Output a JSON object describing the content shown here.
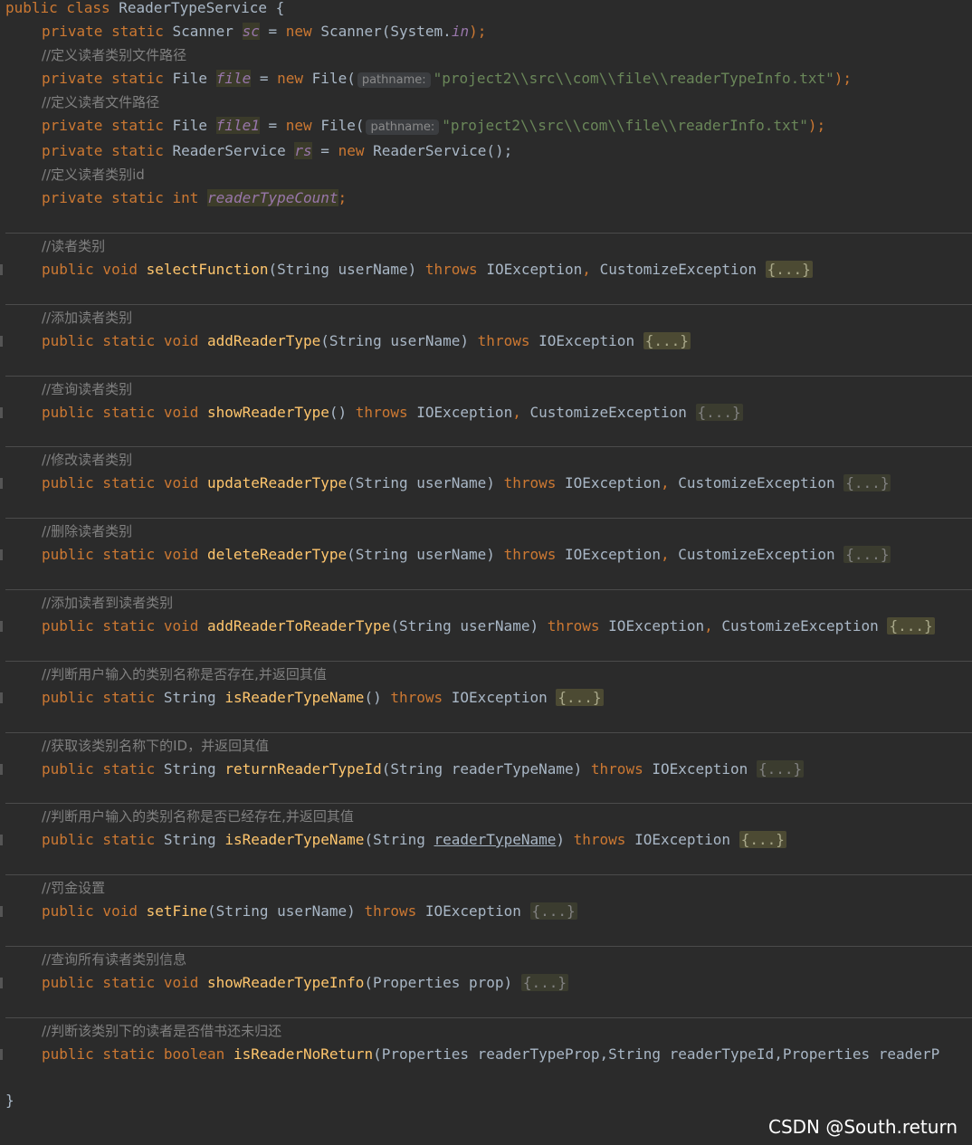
{
  "class_header": {
    "modifiers": "public class",
    "name": "ReaderTypeService",
    "brace": "{"
  },
  "fields": {
    "sc": {
      "mods": "private static",
      "type": "Scanner",
      "name": "sc",
      "assign": "=",
      "new_kw": "new",
      "init": "Scanner(System.",
      "in_field": "in",
      "tail": ");"
    },
    "c1": "//定义读者类别文件路径",
    "file": {
      "mods": "private static",
      "type": "File",
      "name": "file",
      "assign": "=",
      "new_kw": "new",
      "ctor": "File(",
      "hint": "pathname:",
      "path": "\"project2\\\\src\\\\com\\\\file\\\\readerTypeInfo.txt\"",
      "tail": ");"
    },
    "c2": "//定义读者文件路径",
    "file1": {
      "mods": "private static",
      "type": "File",
      "name": "file1",
      "assign": "=",
      "new_kw": "new",
      "ctor": "File(",
      "hint": "pathname:",
      "path": "\"project2\\\\src\\\\com\\\\file\\\\readerInfo.txt\"",
      "tail": ");"
    },
    "rs": {
      "mods": "private static",
      "type": "ReaderService",
      "name": "rs",
      "assign": "=",
      "new_kw": "new",
      "init": "ReaderService();"
    },
    "c3": "//定义读者类别id",
    "count": {
      "mods": "private static",
      "type": "int",
      "name": "readerTypeCount",
      "semi": ";"
    }
  },
  "methods": [
    {
      "comment": "//读者类别",
      "mods": "public void",
      "ret": "",
      "name": "selectFunction",
      "params": "(String userName)",
      "throws": "throws",
      "ex": "IOException",
      "ex2": "CustomizeException",
      "fold": "{...}"
    },
    {
      "comment": "//添加读者类别",
      "mods": "public static void",
      "ret": "",
      "name": "addReaderType",
      "params": "(String userName)",
      "throws": "throws",
      "ex": "IOException",
      "ex2": "",
      "fold": "{...}"
    },
    {
      "comment": "//查询读者类别",
      "mods": "public static void",
      "ret": "",
      "name": "showReaderType",
      "params": "()",
      "throws": "throws",
      "ex": "IOException",
      "ex2": "CustomizeException",
      "fold": "{...}"
    },
    {
      "comment": "//修改读者类别",
      "mods": "public static void",
      "ret": "",
      "name": "updateReaderType",
      "params": "(String userName)",
      "throws": "throws",
      "ex": "IOException",
      "ex2": "CustomizeException",
      "fold": "{...}"
    },
    {
      "comment": "//删除读者类别",
      "mods": "public static void",
      "ret": "",
      "name": "deleteReaderType",
      "params": "(String userName)",
      "throws": "throws",
      "ex": "IOException",
      "ex2": "CustomizeException",
      "fold": "{...}"
    },
    {
      "comment": "//添加读者到读者类别",
      "mods": "public static void",
      "ret": "",
      "name": "addReaderToReaderType",
      "params": "(String userName)",
      "throws": "throws",
      "ex": "IOException",
      "ex2": "CustomizeException",
      "fold": "{...}"
    },
    {
      "comment": "//判断用户输入的类别名称是否存在,并返回其值",
      "mods": "public static",
      "ret": "String",
      "name": "isReaderTypeName",
      "params": "()",
      "throws": "throws",
      "ex": "IOException",
      "ex2": "",
      "fold": "{...}"
    },
    {
      "comment": "//获取该类别名称下的ID，并返回其值",
      "mods": "public static",
      "ret": "String",
      "name": "returnReaderTypeId",
      "params": "(String readerTypeName)",
      "throws": "throws",
      "ex": "IOException",
      "ex2": "",
      "fold": "{...}"
    },
    {
      "comment": "//判断用户输入的类别名称是否已经存在,并返回其值",
      "mods": "public static",
      "ret": "String",
      "name": "isReaderTypeName",
      "params_pre": "(String ",
      "params_ul": "readerTypeName",
      "params_post": ")",
      "throws": "throws",
      "ex": "IOException",
      "ex2": "",
      "fold": "{...}"
    },
    {
      "comment": "//罚金设置",
      "mods": "public void",
      "ret": "",
      "name": "setFine",
      "params": "(String userName)",
      "throws": "throws",
      "ex": "IOException",
      "ex2": "",
      "fold": "{...}"
    },
    {
      "comment": "//查询所有读者类别信息",
      "mods": "public static void",
      "ret": "",
      "name": "showReaderTypeInfo",
      "params": "(Properties prop)",
      "throws": "",
      "ex": "",
      "ex2": "",
      "fold": "{...}"
    },
    {
      "comment": "//判断该类别下的读者是否借书还未归还",
      "mods": "public static",
      "ret": "boolean",
      "name": "isReaderNoReturn",
      "params": "(Properties readerTypeProp,String readerTypeId,Properties readerP",
      "throws": "",
      "ex": "",
      "ex2": "",
      "fold": ""
    }
  ],
  "closing_brace": "}",
  "watermark": "CSDN @South.return"
}
